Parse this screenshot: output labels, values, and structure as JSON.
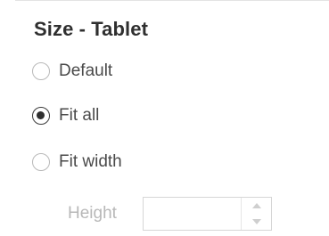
{
  "section": {
    "title": "Size - Tablet"
  },
  "options": [
    {
      "label": "Default",
      "checked": false
    },
    {
      "label": "Fit all",
      "checked": true
    },
    {
      "label": "Fit width",
      "checked": false
    }
  ],
  "height_field": {
    "label": "Height",
    "value": "",
    "disabled": true
  },
  "colors": {
    "title": "#2f2f2f",
    "label": "#4a4a4a",
    "disabled": "#b8b8b8",
    "radio_border": "#b9b9b9",
    "radio_checked": "#2f2f2f"
  },
  "icons": {
    "step_up": "triangle-up-icon",
    "step_down": "triangle-down-icon"
  }
}
